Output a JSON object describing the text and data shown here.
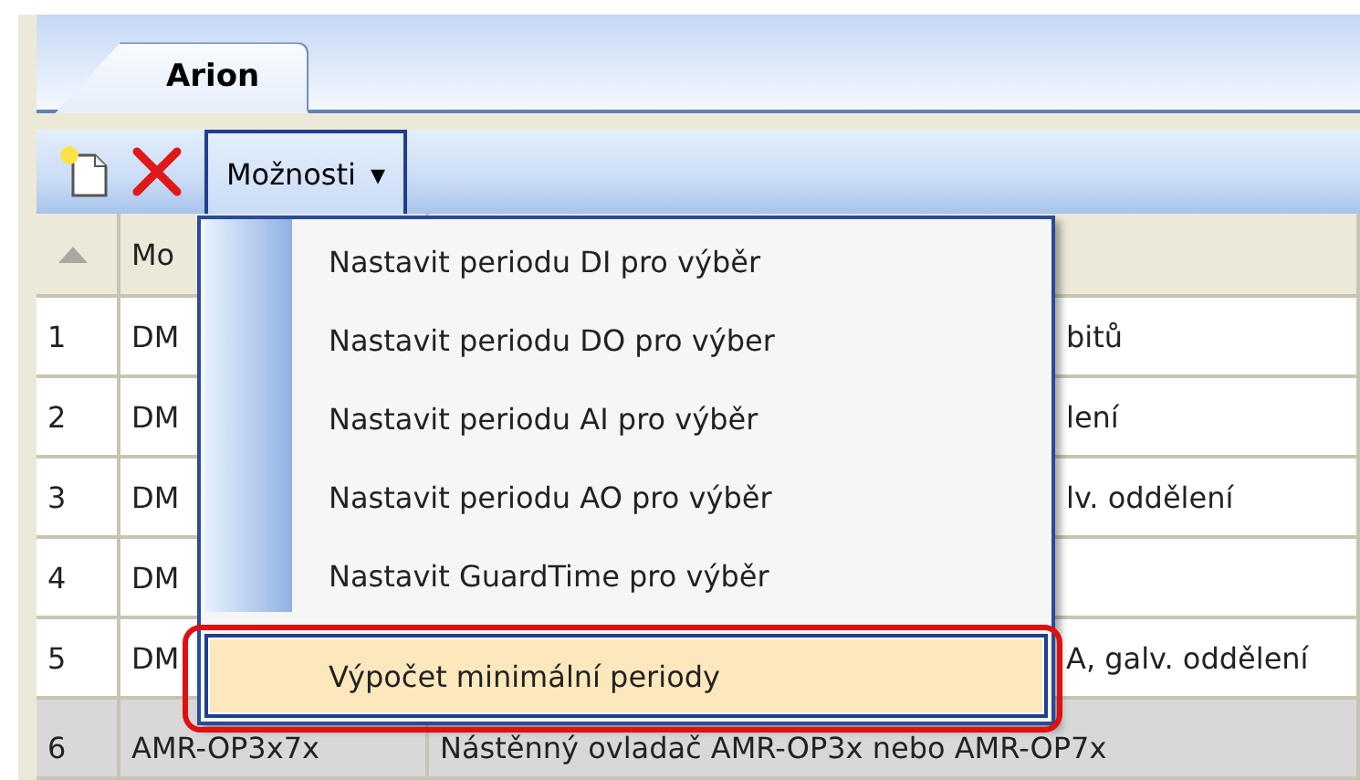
{
  "tabs": [
    {
      "label": "Arion",
      "selected": true
    }
  ],
  "toolbar": {
    "menu_button": {
      "label": "Možnosti",
      "caret": "▾",
      "open": true
    }
  },
  "table": {
    "columns": [
      "",
      "Mo",
      ""
    ],
    "rows": [
      {
        "cells": [
          "1",
          "DM",
          "bitů"
        ],
        "selected": false
      },
      {
        "cells": [
          "2",
          "DM",
          "lení"
        ],
        "selected": false
      },
      {
        "cells": [
          "3",
          "DM",
          "lv. oddělení"
        ],
        "selected": false
      },
      {
        "cells": [
          "4",
          "DM",
          ""
        ],
        "selected": false
      },
      {
        "cells": [
          "5",
          "DM",
          "A, galv. oddělení"
        ],
        "selected": false
      },
      {
        "cells": [
          "6",
          "AMR-OP3x7x",
          "Nástěnný ovladač AMR-OP3x nebo AMR-OP7x"
        ],
        "selected": true
      }
    ]
  },
  "menu": {
    "items": [
      {
        "label": "Nastavit periodu DI pro výběr",
        "selected": false
      },
      {
        "label": "Nastavit periodu DO pro výber",
        "selected": false
      },
      {
        "label": "Nastavit periodu AI pro výběr",
        "selected": false
      },
      {
        "label": "Nastavit periodu AO pro výběr",
        "selected": false
      },
      {
        "label": "Nastavit GuardTime pro výběr",
        "selected": false
      },
      {
        "kind": "separator"
      },
      {
        "label": "Výpočet minimální periody",
        "selected": true
      }
    ]
  }
}
